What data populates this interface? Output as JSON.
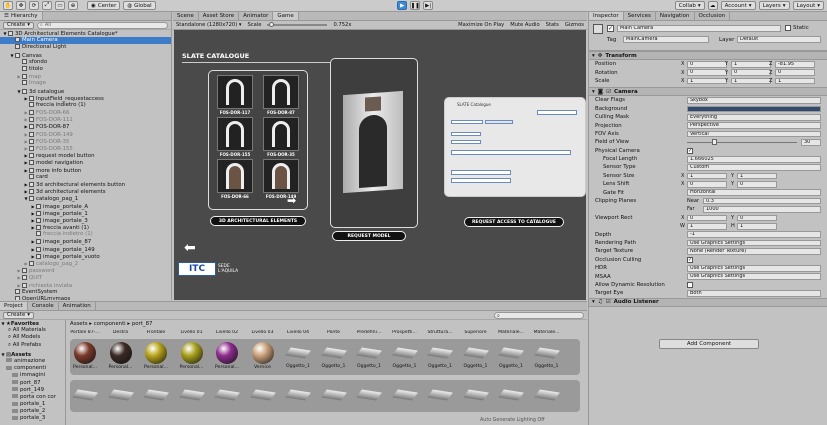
{
  "toolbar": {
    "center_label": "Center",
    "global_label": "Global",
    "collab_label": "Collab",
    "account_label": "Account",
    "layers_label": "Layers",
    "layout_label": "Layout"
  },
  "hierarchy": {
    "tab_label": "Hierarchy",
    "create_label": "Create",
    "search_placeholder": "All",
    "items": [
      {
        "label": "3D Architectural Elements Catalogue*",
        "depth": 0,
        "state": "open",
        "selected": false,
        "dim": false
      },
      {
        "label": "Main Camera",
        "depth": 1,
        "state": "none",
        "selected": true,
        "dim": false
      },
      {
        "label": "Directional Light",
        "depth": 1,
        "state": "none",
        "selected": false,
        "dim": false
      },
      {
        "label": "Canvas",
        "depth": 1,
        "state": "open",
        "selected": false,
        "dim": false
      },
      {
        "label": "sfondo",
        "depth": 2,
        "state": "none",
        "selected": false,
        "dim": false
      },
      {
        "label": "titolo",
        "depth": 2,
        "state": "none",
        "selected": false,
        "dim": false
      },
      {
        "label": "map",
        "depth": 2,
        "state": "closed",
        "selected": false,
        "dim": true
      },
      {
        "label": "Image",
        "depth": 2,
        "state": "none",
        "selected": false,
        "dim": true
      },
      {
        "label": "3d catalogue",
        "depth": 2,
        "state": "open",
        "selected": false,
        "dim": false
      },
      {
        "label": "InputField_requestaccess",
        "depth": 3,
        "state": "closed",
        "selected": false,
        "dim": false
      },
      {
        "label": "freccia indietro (1)",
        "depth": 3,
        "state": "none",
        "selected": false,
        "dim": false
      },
      {
        "label": "FOS-DOR-66",
        "depth": 3,
        "state": "closed",
        "selected": false,
        "dim": true
      },
      {
        "label": "FOS-DOR-111",
        "depth": 3,
        "state": "closed",
        "selected": false,
        "dim": true
      },
      {
        "label": "FOS-DOR-87",
        "depth": 3,
        "state": "closed",
        "selected": false,
        "dim": false
      },
      {
        "label": "FOS-DOR-149",
        "depth": 3,
        "state": "closed",
        "selected": false,
        "dim": true
      },
      {
        "label": "FOS-DOR-35",
        "depth": 3,
        "state": "closed",
        "selected": false,
        "dim": true
      },
      {
        "label": "FOS-DOR-155",
        "depth": 3,
        "state": "closed",
        "selected": false,
        "dim": true
      },
      {
        "label": "request model button",
        "depth": 3,
        "state": "closed",
        "selected": false,
        "dim": false
      },
      {
        "label": "model navigation",
        "depth": 3,
        "state": "closed",
        "selected": false,
        "dim": false
      },
      {
        "label": "more info button",
        "depth": 3,
        "state": "closed",
        "selected": false,
        "dim": false
      },
      {
        "label": "card",
        "depth": 3,
        "state": "none",
        "selected": false,
        "dim": false
      },
      {
        "label": "3d architectural elements button",
        "depth": 3,
        "state": "closed",
        "selected": false,
        "dim": false
      },
      {
        "label": "3d architectural elements",
        "depth": 3,
        "state": "closed",
        "selected": false,
        "dim": false
      },
      {
        "label": "catalogo_pag_1",
        "depth": 3,
        "state": "open",
        "selected": false,
        "dim": false
      },
      {
        "label": "image_portale_A",
        "depth": 4,
        "state": "closed",
        "selected": false,
        "dim": false
      },
      {
        "label": "image_portale_1",
        "depth": 4,
        "state": "closed",
        "selected": false,
        "dim": false
      },
      {
        "label": "image_portale_3",
        "depth": 4,
        "state": "closed",
        "selected": false,
        "dim": false
      },
      {
        "label": "freccia avanti (1)",
        "depth": 4,
        "state": "closed",
        "selected": false,
        "dim": false
      },
      {
        "label": "freccia indietro (1)",
        "depth": 4,
        "state": "none",
        "selected": false,
        "dim": true
      },
      {
        "label": "image_portale_87",
        "depth": 4,
        "state": "closed",
        "selected": false,
        "dim": false
      },
      {
        "label": "image_portale_149",
        "depth": 4,
        "state": "closed",
        "selected": false,
        "dim": false
      },
      {
        "label": "image_portale_vuoto",
        "depth": 4,
        "state": "closed",
        "selected": false,
        "dim": false
      },
      {
        "label": "catalogo_pag_2",
        "depth": 3,
        "state": "closed",
        "selected": false,
        "dim": true
      },
      {
        "label": "password",
        "depth": 2,
        "state": "closed",
        "selected": false,
        "dim": true
      },
      {
        "label": "QUIT",
        "depth": 2,
        "state": "closed",
        "selected": false,
        "dim": true
      },
      {
        "label": "richiesta inviata",
        "depth": 2,
        "state": "closed",
        "selected": false,
        "dim": true
      },
      {
        "label": "EventSystem",
        "depth": 1,
        "state": "none",
        "selected": false,
        "dim": false
      },
      {
        "label": "OpenURLmymaps",
        "depth": 1,
        "state": "none",
        "selected": false,
        "dim": false
      },
      {
        "label": "menumanager",
        "depth": 1,
        "state": "none",
        "selected": false,
        "dim": false
      }
    ]
  },
  "center_tabs": [
    {
      "label": "Scene",
      "active": false
    },
    {
      "label": "Asset Store",
      "active": false
    },
    {
      "label": "Animator",
      "active": false
    },
    {
      "label": "Game",
      "active": true
    }
  ],
  "game_toolbar": {
    "display": "Standalone (1280x720)",
    "scale_label": "Scale",
    "scale_value": "0.752x",
    "maximize": "Maximize On Play",
    "mute": "Mute Audio",
    "stats": "Stats",
    "gizmos": "Gizmos"
  },
  "game": {
    "title": "SLATE CATALOGUE",
    "thumbs": [
      {
        "label": "FOS-DOR-117"
      },
      {
        "label": "FOS-DOR-87"
      },
      {
        "label": "FOS-DOR-155"
      },
      {
        "label": "FOS-DOR-35"
      },
      {
        "label": "FOS-DOR-66"
      },
      {
        "label": "FOS-DOR-149"
      }
    ],
    "btn_elements": "3D ARCHITECTURAL ELEMENTS",
    "btn_request_model": "REQUEST MODEL",
    "btn_request_access": "REQUEST ACCESS TO CATALOGUE",
    "form_title": "SLATE Catalogue",
    "logo_text": "ITC",
    "logo_sub_1": "SEDE",
    "logo_sub_2": "L'AQUILA"
  },
  "bottom": {
    "tabs": [
      {
        "label": "Project",
        "active": true
      },
      {
        "label": "Console",
        "active": false
      },
      {
        "label": "Animation",
        "active": false
      }
    ],
    "create_label": "Create",
    "favorites_label": "Favorites",
    "favorites": [
      "All Materials",
      "All Models",
      "All Prefabs"
    ],
    "assets_label": "Assets",
    "folders": [
      "animazione",
      "componenti",
      "immagini",
      "port_87",
      "port_149",
      "porta con cor",
      "portale_1",
      "portale_2",
      "portale_3"
    ],
    "breadcrumb": [
      "Assets",
      "componenti",
      "port_87"
    ],
    "headers": [
      "Portale 87-...",
      "Destra",
      "Frontale",
      "Livello 01",
      "Livello 02",
      "Livello 03",
      "Livello 04",
      "Ponte",
      "Predefini...",
      "Prospetti...",
      "Struttura...",
      "Superiore",
      "Materiale...",
      "Materiale..."
    ],
    "row1": [
      {
        "label": "Personal...",
        "kind": "ball",
        "color": "#7a3a2a"
      },
      {
        "label": "Personal...",
        "kind": "ball",
        "color": "#3b2a25"
      },
      {
        "label": "Personal...",
        "kind": "ball",
        "color": "#b8a51a"
      },
      {
        "label": "Personal...",
        "kind": "ball",
        "color": "#a8a01c"
      },
      {
        "label": "Personal...",
        "kind": "ball",
        "color": "#8e2c8e"
      },
      {
        "label": "Vernice",
        "kind": "ball",
        "color": "#c9a07a"
      },
      {
        "label": "Oggetto_1",
        "kind": "plank"
      },
      {
        "label": "Oggetto_1",
        "kind": "plank"
      },
      {
        "label": "Oggetto_1",
        "kind": "plank"
      },
      {
        "label": "Oggetto_1",
        "kind": "plank"
      },
      {
        "label": "Oggetto_1",
        "kind": "plank"
      },
      {
        "label": "Oggetto_1",
        "kind": "plank"
      },
      {
        "label": "Oggetto_1",
        "kind": "plank"
      },
      {
        "label": "Oggetto_1",
        "kind": "plank"
      }
    ],
    "status_text": "Auto Generate Lighting Off"
  },
  "inspector": {
    "tabs": [
      {
        "label": "Inspector",
        "active": true
      },
      {
        "label": "Services",
        "active": false
      },
      {
        "label": "Navigation",
        "active": false
      },
      {
        "label": "Occlusion",
        "active": false
      }
    ],
    "object_name": "Main Camera",
    "static_label": "Static",
    "tag_label": "Tag",
    "tag_value": "MainCamera",
    "layer_label": "Layer",
    "layer_value": "Default",
    "transform_title": "Transform",
    "transform": [
      {
        "label": "Position",
        "x": "0",
        "y": "1",
        "z": "-81.95"
      },
      {
        "label": "Rotation",
        "x": "0",
        "y": "0",
        "z": "0"
      },
      {
        "label": "Scale",
        "x": "1",
        "y": "1",
        "z": "1"
      }
    ],
    "camera_title": "Camera",
    "camera_props": [
      {
        "label": "Clear Flags",
        "value": "Skybox",
        "kind": "dropdown",
        "indent": false
      },
      {
        "label": "Background",
        "value": "",
        "kind": "color",
        "indent": false
      },
      {
        "label": "Culling Mask",
        "value": "Everything",
        "kind": "dropdown",
        "indent": false
      },
      {
        "label": "Projection",
        "value": "Perspective",
        "kind": "dropdown",
        "indent": false
      },
      {
        "label": "FOV Axis",
        "value": "Vertical",
        "kind": "dropdown",
        "indent": false
      },
      {
        "label": "Field of View",
        "value": "30",
        "kind": "slider",
        "indent": false
      },
      {
        "label": "Physical Camera",
        "value": "",
        "kind": "check",
        "indent": false
      },
      {
        "label": "Focal Length",
        "value": "1.666025",
        "kind": "field",
        "indent": true
      },
      {
        "label": "Sensor Type",
        "value": "Custom",
        "kind": "dropdown",
        "indent": true
      },
      {
        "label": "Sensor Size",
        "value": "",
        "kind": "xy",
        "x": "1",
        "y": "1",
        "indent": true
      },
      {
        "label": "Lens Shift",
        "value": "",
        "kind": "xy",
        "x": "0",
        "y": "0",
        "indent": true
      },
      {
        "label": "Gate Fit",
        "value": "Horizontal",
        "kind": "dropdown",
        "indent": true
      },
      {
        "label": "Clipping Planes",
        "value": "",
        "kind": "nearfar",
        "near": "0.3",
        "near_label": "Near",
        "indent": false
      },
      {
        "label": "",
        "value": "",
        "kind": "nearfar2",
        "far": "1000",
        "far_label": "Far",
        "indent": false
      },
      {
        "label": "Viewport Rect",
        "value": "",
        "kind": "xy",
        "x": "0",
        "y": "0",
        "indent": false
      },
      {
        "label": "",
        "value": "",
        "kind": "wh",
        "w": "1",
        "h": "1",
        "indent": false
      },
      {
        "label": "Depth",
        "value": "-1",
        "kind": "field",
        "indent": false
      },
      {
        "label": "Rendering Path",
        "value": "Use Graphics Settings",
        "kind": "dropdown",
        "indent": false
      },
      {
        "label": "Target Texture",
        "value": "None (Render Texture)",
        "kind": "field",
        "indent": false
      },
      {
        "label": "Occlusion Culling",
        "value": "",
        "kind": "check",
        "indent": false
      },
      {
        "label": "HDR",
        "value": "Use Graphics Settings",
        "kind": "dropdown",
        "indent": false
      },
      {
        "label": "MSAA",
        "value": "Use Graphics Settings",
        "kind": "dropdown",
        "indent": false
      },
      {
        "label": "Allow Dynamic Resolution",
        "value": "",
        "kind": "checkoff",
        "indent": false
      },
      {
        "label": "Target Eye",
        "value": "Both",
        "kind": "dropdown",
        "indent": false
      }
    ],
    "audio_title": "Audio Listener",
    "add_component": "Add Component"
  }
}
